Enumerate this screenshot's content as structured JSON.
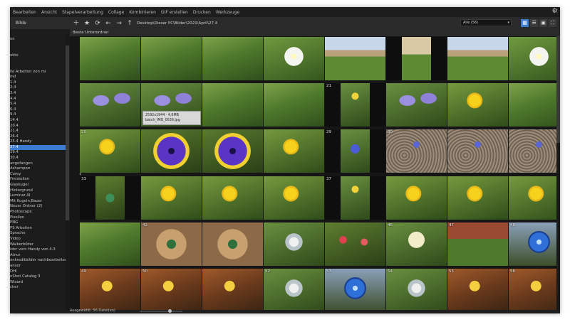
{
  "menu": [
    "Bearbeiten",
    "Ansicht",
    "Stapelverarbeitung",
    "Collage",
    "Kombinieren",
    "GIF erstellen",
    "Drucken",
    "Werkzeuge"
  ],
  "sidebar": {
    "header": "Bilde",
    "items": [
      {
        "label": "en",
        "selected": false
      },
      {
        "label": "",
        "selected": false
      },
      {
        "label": "",
        "selected": false
      },
      {
        "label": "okto",
        "selected": false
      },
      {
        "label": "",
        "selected": false
      },
      {
        "label": "",
        "selected": false
      },
      {
        "label": "lle Arbeiten von mi",
        "selected": false
      },
      {
        "label": "ind",
        "selected": false
      },
      {
        "label": "  1.4",
        "selected": false
      },
      {
        "label": "  2.4",
        "selected": false
      },
      {
        "label": "  3.4",
        "selected": false
      },
      {
        "label": "  4.4",
        "selected": false
      },
      {
        "label": "  5.4",
        "selected": false
      },
      {
        "label": "  6.4",
        "selected": false
      },
      {
        "label": "  9.4",
        "selected": false
      },
      {
        "label": "  14.4",
        "selected": false
      },
      {
        "label": "  20.4",
        "selected": false
      },
      {
        "label": "  21.4",
        "selected": false
      },
      {
        "label": "  26.4",
        "selected": false
      },
      {
        "label": "  25.4 Handy",
        "selected": false
      },
      {
        "label": "  27.4",
        "selected": true
      },
      {
        "label": "  29.4",
        "selected": false
      },
      {
        "label": "  30.4",
        "selected": false
      },
      {
        "label": "  angefangen",
        "selected": false
      },
      {
        "label": "  Ashampoo",
        "selected": false
      },
      {
        "label": "  Corey",
        "selected": false
      },
      {
        "label": "  Freistellen",
        "selected": false
      },
      {
        "label": "  Glaskugel",
        "selected": false
      },
      {
        "label": "  Hintergrund",
        "selected": false
      },
      {
        "label": "  Luminar AI",
        "selected": false
      },
      {
        "label": "  Mit Kugeln,Bauer",
        "selected": false
      },
      {
        "label": "  Neuer Ordner (2)",
        "selected": false
      },
      {
        "label": "  Photoscape",
        "selected": false
      },
      {
        "label": "  Pixelize",
        "selected": false
      },
      {
        "label": "  PNG",
        "selected": false
      },
      {
        "label": "  PS Arbeiten",
        "selected": false
      },
      {
        "label": "  Sprache",
        "selected": false
      },
      {
        "label": "  Video",
        "selected": false
      },
      {
        "label": "  Walkerbilder",
        "selected": false
      },
      {
        "label": "lder vom Handy von 4.3",
        "selected": false
      },
      {
        "label": "Atnur",
        "selected": false
      },
      {
        "label": "onkreditbilder nachbearbeiter",
        "selected": false
      },
      {
        "label": "anser",
        "selected": false
      },
      {
        "label": "DHI",
        "selected": false
      },
      {
        "label": "nShot Catalog 3",
        "selected": false
      },
      {
        "label": "Wizard",
        "selected": false
      },
      {
        "label": "cher",
        "selected": false
      }
    ]
  },
  "toolbar": {
    "path": "Desktop\\Dieser PC\\Bilder\\2021\\April\\27.4",
    "filter": "Alle (56)",
    "icons": [
      "plus-icon",
      "star-icon",
      "refresh-icon",
      "back-icon",
      "forward-icon",
      "up-icon"
    ]
  },
  "breadcrumb": "Beste Unterordner",
  "tooltip": {
    "line1": "2592x1944 · 4,6MB",
    "line2": "batch_IMG_0039.jpg"
  },
  "status": {
    "text": "Ausgewählt: 56 Datei(en)"
  },
  "thumbnails": [
    {
      "n": "",
      "scene": "grass"
    },
    {
      "n": "",
      "scene": "grass"
    },
    {
      "n": "",
      "scene": "grass"
    },
    {
      "n": "",
      "scene": "daisy"
    },
    {
      "n": "",
      "scene": "garden"
    },
    {
      "n": "",
      "scene": "garden-narrow"
    },
    {
      "n": "",
      "scene": "garden"
    },
    {
      "n": "",
      "scene": "daisy"
    },
    {
      "n": "",
      "scene": "purple-crocus"
    },
    {
      "n": "",
      "scene": "purple-crocus"
    },
    {
      "n": "",
      "scene": "grass"
    },
    {
      "n": "",
      "scene": "grass"
    },
    {
      "n": "21",
      "scene": "yellow-narrow"
    },
    {
      "n": "",
      "scene": "purple-crocus"
    },
    {
      "n": "",
      "scene": "dandelion"
    },
    {
      "n": "",
      "scene": "grass"
    },
    {
      "n": "25",
      "scene": "dandelion"
    },
    {
      "n": "",
      "scene": "pansy"
    },
    {
      "n": "",
      "scene": "pansy"
    },
    {
      "n": "",
      "scene": "dandelion"
    },
    {
      "n": "29",
      "scene": "blue-narrow"
    },
    {
      "n": "30",
      "scene": "gravel-flowers"
    },
    {
      "n": "",
      "scene": "gravel-flowers"
    },
    {
      "n": "",
      "scene": "gravel-flowers"
    },
    {
      "n": "33",
      "scene": "glass-narrow"
    },
    {
      "n": "",
      "scene": "dandelion"
    },
    {
      "n": "",
      "scene": "dandelion"
    },
    {
      "n": "",
      "scene": "dandelion"
    },
    {
      "n": "37",
      "scene": "yellow-narrow"
    },
    {
      "n": "",
      "scene": "dandelion"
    },
    {
      "n": "",
      "scene": "dandelion"
    },
    {
      "n": "",
      "scene": "dandelion"
    },
    {
      "n": "",
      "scene": "grass"
    },
    {
      "n": "42",
      "scene": "ornament"
    },
    {
      "n": "",
      "scene": "ornament"
    },
    {
      "n": "",
      "scene": "glass-ball"
    },
    {
      "n": "",
      "scene": "tulips"
    },
    {
      "n": "46",
      "scene": "white-flower"
    },
    {
      "n": "47",
      "scene": "wall-flowers"
    },
    {
      "n": "48",
      "scene": "blue-ball"
    },
    {
      "n": "49",
      "scene": "rust-ball"
    },
    {
      "n": "50",
      "scene": "rust-ball"
    },
    {
      "n": "",
      "scene": "rust-ball"
    },
    {
      "n": "52",
      "scene": "glass-ball"
    },
    {
      "n": "53",
      "scene": "blue-ball"
    },
    {
      "n": "54",
      "scene": "glass-ball"
    },
    {
      "n": "55",
      "scene": "rust-ball"
    },
    {
      "n": "56",
      "scene": "rust-ball"
    }
  ]
}
